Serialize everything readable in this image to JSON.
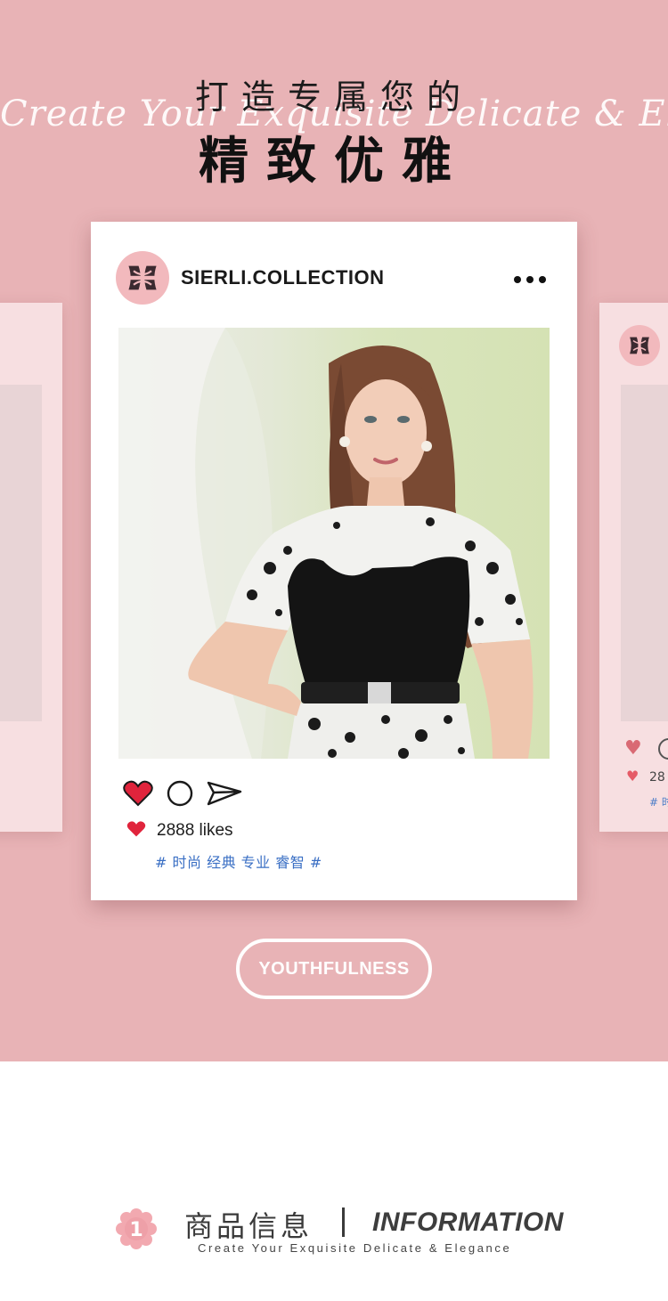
{
  "hero": {
    "script_text": "Create Your Exquisite Delicate & Elegance",
    "title_line1": "打造专属您的",
    "title_line2": "精致优雅",
    "background_color": "#e8b3b6"
  },
  "post": {
    "username": "SIERLI.COLLECTION",
    "more_icon": "more-dots-icon",
    "likes_text": "2888 likes",
    "tags_text": "# 时尚 经典 专业 睿智 #",
    "accent_color": "#e0243c",
    "tag_color": "#3a6fc4"
  },
  "side_card_right": {
    "likes_text": "28",
    "tags_text": "# 时"
  },
  "pill": {
    "label": "YOUTHFULNESS"
  },
  "info": {
    "number": "1",
    "title_cn": "商品信息",
    "title_en": "INFORMATION",
    "subtitle": "Create Your Exquisite Delicate & Elegance"
  }
}
